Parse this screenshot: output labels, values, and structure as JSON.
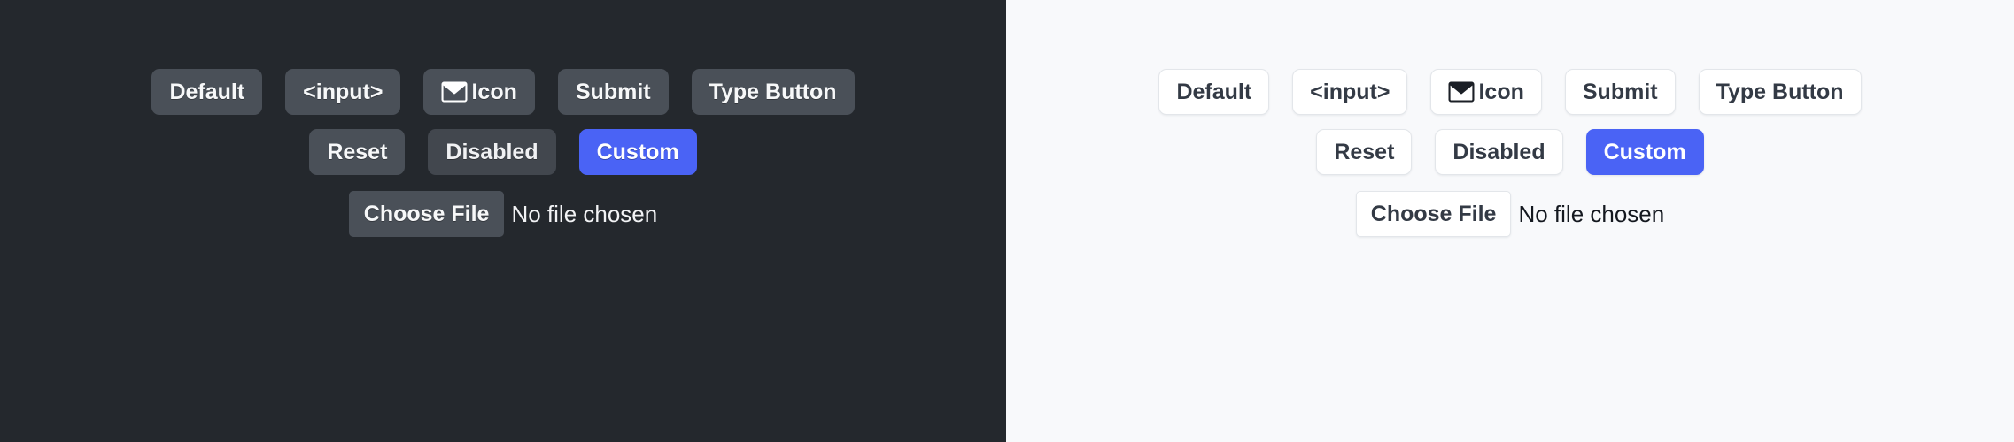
{
  "panels": [
    {
      "name": "dark-theme-panel",
      "theme": "dark",
      "background_color": "#24282d",
      "text_color": "#f7f8f9",
      "button_bg_color": "#4a5058",
      "accent_color": "#4a63f5",
      "rows": [
        {
          "name": "row-primary-buttons",
          "buttons": [
            {
              "label": "Default",
              "variant": "default",
              "icon": null
            },
            {
              "label": "<input>",
              "variant": "default",
              "icon": null
            },
            {
              "label": "Icon",
              "variant": "default",
              "icon": "envelope-icon"
            },
            {
              "label": "Submit",
              "variant": "default",
              "icon": null
            },
            {
              "label": "Type Button",
              "variant": "default",
              "icon": null
            }
          ]
        },
        {
          "name": "row-secondary-buttons",
          "buttons": [
            {
              "label": "Reset",
              "variant": "default",
              "icon": null
            },
            {
              "label": "Disabled",
              "variant": "muted",
              "icon": null
            },
            {
              "label": "Custom",
              "variant": "accent",
              "icon": null
            }
          ]
        }
      ],
      "file_input": {
        "button_label": "Choose File",
        "status_text": "No file chosen"
      }
    },
    {
      "name": "light-theme-panel",
      "theme": "light",
      "background_color": "#f8f9fb",
      "text_color": "#333a45",
      "button_bg_color": "#ffffff",
      "border_color": "#e3e6ea",
      "accent_color": "#4a63f5",
      "rows": [
        {
          "name": "row-primary-buttons",
          "buttons": [
            {
              "label": "Default",
              "variant": "default",
              "icon": null
            },
            {
              "label": "<input>",
              "variant": "default",
              "icon": null
            },
            {
              "label": "Icon",
              "variant": "default",
              "icon": "envelope-icon"
            },
            {
              "label": "Submit",
              "variant": "default",
              "icon": null
            },
            {
              "label": "Type Button",
              "variant": "default",
              "icon": null
            }
          ]
        },
        {
          "name": "row-secondary-buttons",
          "buttons": [
            {
              "label": "Reset",
              "variant": "default",
              "icon": null
            },
            {
              "label": "Disabled",
              "variant": "muted",
              "icon": null
            },
            {
              "label": "Custom",
              "variant": "accent",
              "icon": null
            }
          ]
        }
      ],
      "file_input": {
        "button_label": "Choose File",
        "status_text": "No file chosen"
      }
    }
  ]
}
